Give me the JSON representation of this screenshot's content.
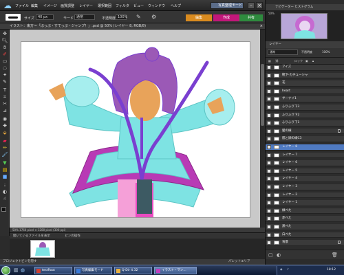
{
  "menubar": {
    "items": [
      "ファイル",
      "編集",
      "イメージ",
      "画質調整",
      "レイヤー",
      "選択範囲",
      "フィルタ",
      "ビュー",
      "ウィンドウ",
      "ヘルプ"
    ],
    "photo_mode": "写真整理モード"
  },
  "options": {
    "size_label": "サイズ",
    "size_value": "40 px",
    "mode_label": "モード",
    "mode_value": "通常",
    "opacity_label": "不透明度",
    "opacity_value": "100%"
  },
  "workspace_tabs": [
    {
      "label": "編集",
      "color": "#d98b1f"
    },
    {
      "label": "作成",
      "color": "#c2177a"
    },
    {
      "label": "共有",
      "color": "#2e8b3e"
    }
  ],
  "document": {
    "title": "イラスト：東方～「ほっぷ・すてっぷ・ジャンプ！」.psd @ 50% (レイヤー 8, RGB/8)",
    "status": "50%      1760 pixel × 1280 pixel (300 ppi)"
  },
  "bin": {
    "header": "開いているファイルを表示",
    "header2": "ビンの操作"
  },
  "bottom": {
    "project_bin": "プロジェクトビンを隠す",
    "palette_area": "パレットエリア"
  },
  "right": {
    "nav_tabs": "ナビゲーター  ヒストグラム",
    "nav_zoom": "50%",
    "layers_tab": "レイヤー",
    "blend": "通常",
    "opacity_label": "不透明度",
    "opacity_value": "100%",
    "lock_label": "ロック"
  },
  "layers": [
    {
      "name": "アイズ",
      "selected": false,
      "lock": false
    },
    {
      "name": "靴下-カチューシャ",
      "selected": false,
      "lock": false
    },
    {
      "name": "花",
      "selected": false,
      "lock": false
    },
    {
      "name": "heart",
      "selected": false,
      "lock": false
    },
    {
      "name": "サーナイ1",
      "selected": false,
      "lock": false
    },
    {
      "name": "ふりふり下3",
      "selected": false,
      "lock": false
    },
    {
      "name": "ふりふり下2",
      "selected": false,
      "lock": false
    },
    {
      "name": "ふりふり下1",
      "selected": false,
      "lock": false
    },
    {
      "name": "髪の線",
      "selected": false,
      "lock": true
    },
    {
      "name": "肌と顔の線C3",
      "selected": false,
      "lock": false
    },
    {
      "name": "レイヤー 8",
      "selected": true,
      "lock": false
    },
    {
      "name": "レイヤー 7",
      "selected": false,
      "lock": false
    },
    {
      "name": "レイヤー 6",
      "selected": false,
      "lock": false
    },
    {
      "name": "レイヤー 5",
      "selected": false,
      "lock": false
    },
    {
      "name": "レイヤー 4",
      "selected": false,
      "lock": false
    },
    {
      "name": "レイヤー 3",
      "selected": false,
      "lock": false
    },
    {
      "name": "レイヤー 2",
      "selected": false,
      "lock": false
    },
    {
      "name": "レイヤー 1",
      "selected": false,
      "lock": false
    },
    {
      "name": "緑べた",
      "selected": false,
      "lock": false
    },
    {
      "name": "赤べた",
      "selected": false,
      "lock": false
    },
    {
      "name": "黒べた",
      "selected": false,
      "lock": false
    },
    {
      "name": "白べた",
      "selected": false,
      "lock": false
    },
    {
      "name": "背景",
      "selected": false,
      "lock": true
    }
  ],
  "taskbar": {
    "buttons": [
      "testRoot",
      "写真編集モード",
      "Q-Dir 4.32",
      "イラスト・マン..."
    ],
    "clock": "18:12"
  },
  "colors": {
    "accent": "#4f7ac2",
    "hair": "#9b59b6",
    "dress": "#7ee3e3",
    "skin": "#e8a35a",
    "ribbon": "#7a3fd0",
    "pink": "#e84cc0"
  }
}
